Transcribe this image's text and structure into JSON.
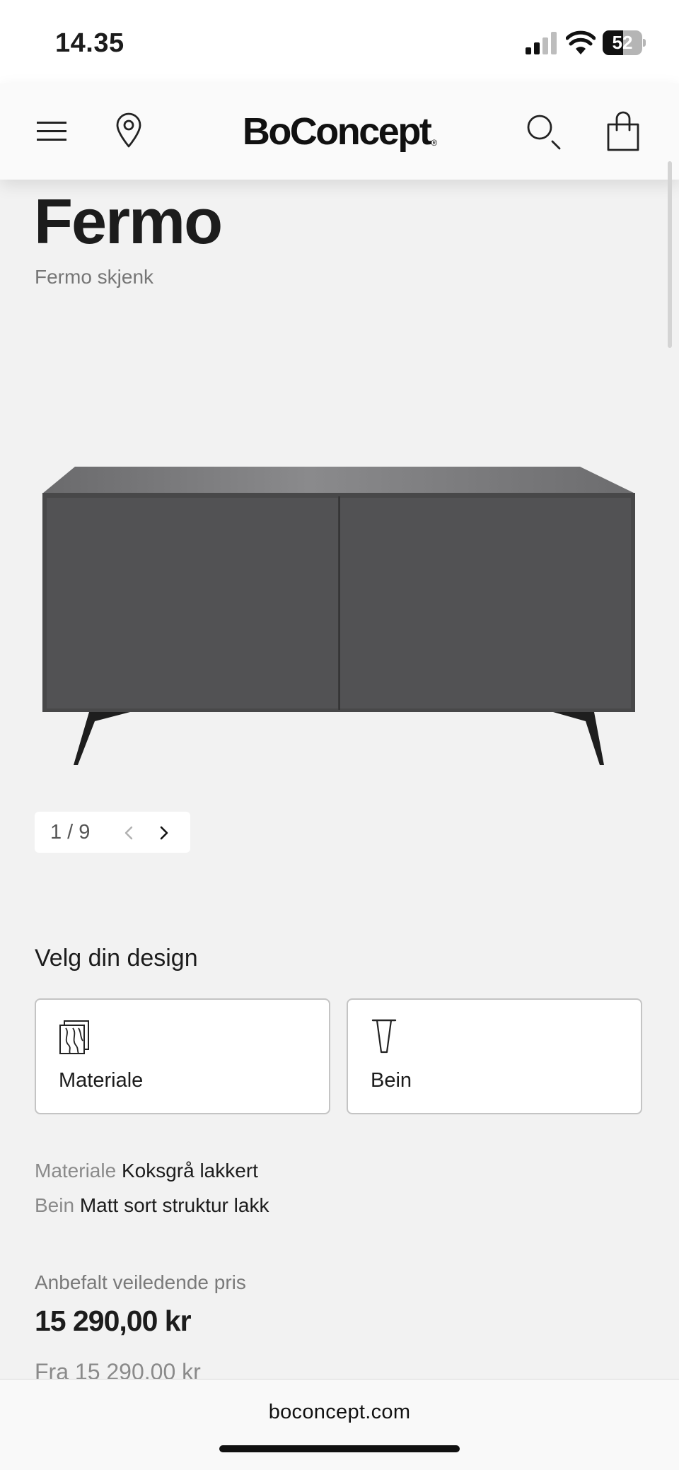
{
  "status_bar": {
    "time": "14.35",
    "battery_percent": "52",
    "battery_level": 0.52
  },
  "header": {
    "brand": "BoConcept",
    "brand_mark": "®"
  },
  "product": {
    "title": "Fermo",
    "subtitle": "Fermo skjenk"
  },
  "gallery": {
    "counter": "1 / 9"
  },
  "design": {
    "heading": "Velg din design",
    "options": [
      {
        "label": "Materiale",
        "icon": "material-icon"
      },
      {
        "label": "Bein",
        "icon": "leg-icon"
      }
    ]
  },
  "specs": [
    {
      "key": "Materiale",
      "value": "Koksgrå lakkert"
    },
    {
      "key": "Bein",
      "value": "Matt sort struktur lakk"
    }
  ],
  "price": {
    "caption": "Anbefalt veiledende pris",
    "amount": "15 290,00 kr",
    "from": "Fra 15 290,00 kr"
  },
  "browser": {
    "url": "boconcept.com"
  },
  "colors": {
    "background": "#f2f2f2",
    "sideboard": "#525254",
    "legs": "#1e1e1e"
  }
}
